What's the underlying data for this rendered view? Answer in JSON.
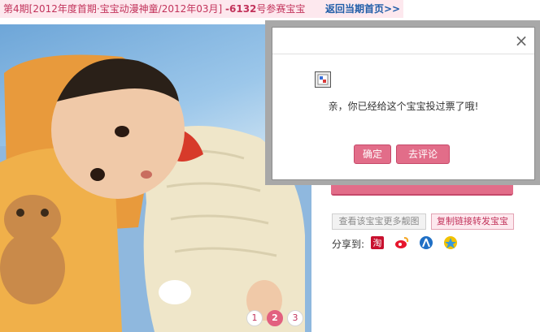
{
  "header": {
    "title_prefix": "第4期[2012年度首期·宝宝动漫神童/2012年03月] ",
    "entry_number": "-6132",
    "title_suffix": "号参赛宝宝",
    "back_link": "返回当期首页>>"
  },
  "photo": {
    "pager": [
      "1",
      "2",
      "3"
    ],
    "active_page": "2"
  },
  "actions": {
    "more_photos": "查看该宝宝更多靓图",
    "copy_link": "复制链接转发宝宝",
    "share_label": "分享到:",
    "share_icons": [
      "taobao-icon",
      "weibo-icon",
      "renren-icon",
      "qzone-icon"
    ]
  },
  "dialog": {
    "message": "亲，你已经给这个宝宝投过票了哦!",
    "confirm": "确定",
    "comment": "去评论",
    "close": "×"
  },
  "colors": {
    "accent_pink": "#e26d89",
    "header_text": "#c2335b",
    "link_blue": "#1f5da8"
  }
}
